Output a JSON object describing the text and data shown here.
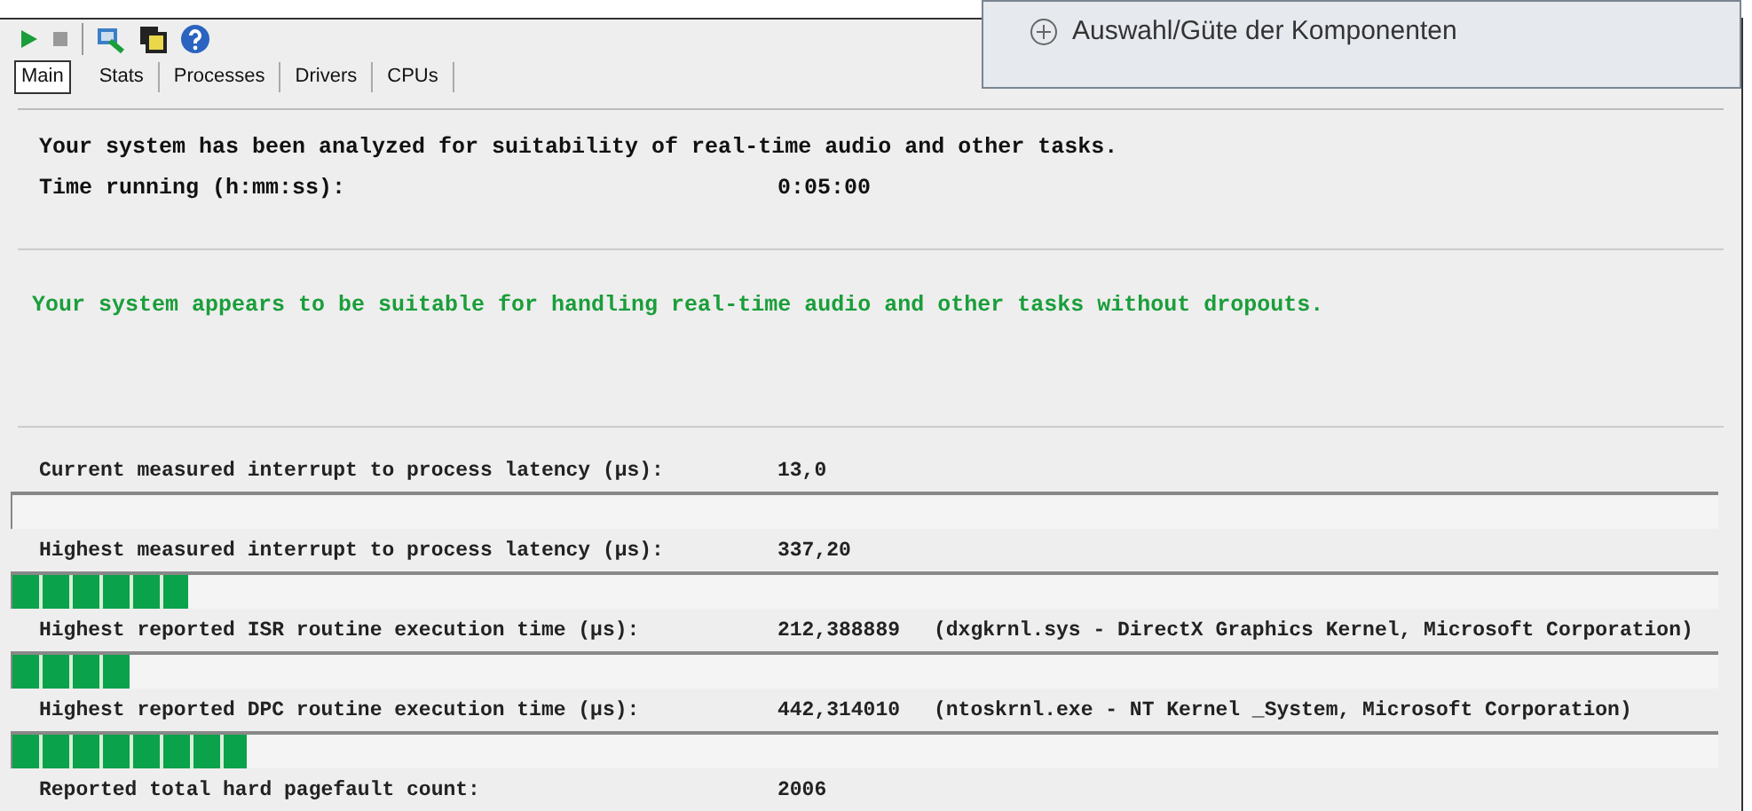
{
  "toolbar": [
    {
      "kind": "start"
    },
    {
      "kind": "stop"
    },
    {
      "kind": "monitor"
    },
    {
      "kind": "windows"
    },
    {
      "kind": "help"
    }
  ],
  "tabs": [
    {
      "label": "Main",
      "selected": true
    },
    {
      "label": "Stats",
      "selected": false
    },
    {
      "label": "Processes",
      "selected": false
    },
    {
      "label": "Drivers",
      "selected": false
    },
    {
      "label": "CPUs",
      "selected": false
    }
  ],
  "overlay": {
    "label": "Auswahl/Güte der Komponenten"
  },
  "summary": {
    "analyzed": "Your system has been analyzed for suitability of real-time audio and other tasks.",
    "time_label": "Time running (h:mm:ss):",
    "time_value": "0:05:00"
  },
  "verdict": "Your system appears to be suitable for handling real-time audio and other tasks without dropouts.",
  "meters": [
    {
      "kind": "bar",
      "label": "Current measured interrupt to process latency (µs):",
      "value": "13,0"
    },
    {
      "kind": "bar",
      "label": "Highest measured interrupt to process latency (µs):",
      "value": "337,20",
      "level": 0.103
    },
    {
      "kind": "bar",
      "label": "Highest reported ISR routine execution time (µs):",
      "value": "212,388889",
      "detail": "(dxgkrnl.sys - DirectX Graphics Kernel, Microsoft Corporation)",
      "level": 0.069
    },
    {
      "kind": "bar",
      "label": "Highest reported DPC routine execution time (µs):",
      "value": "442,314010",
      "detail": "(ntoskrnl.exe - NT Kernel _System, Microsoft Corporation)",
      "level": 0.137
    },
    {
      "kind": "plain",
      "label": "Reported total hard pagefault count:",
      "value": "2006"
    }
  ]
}
